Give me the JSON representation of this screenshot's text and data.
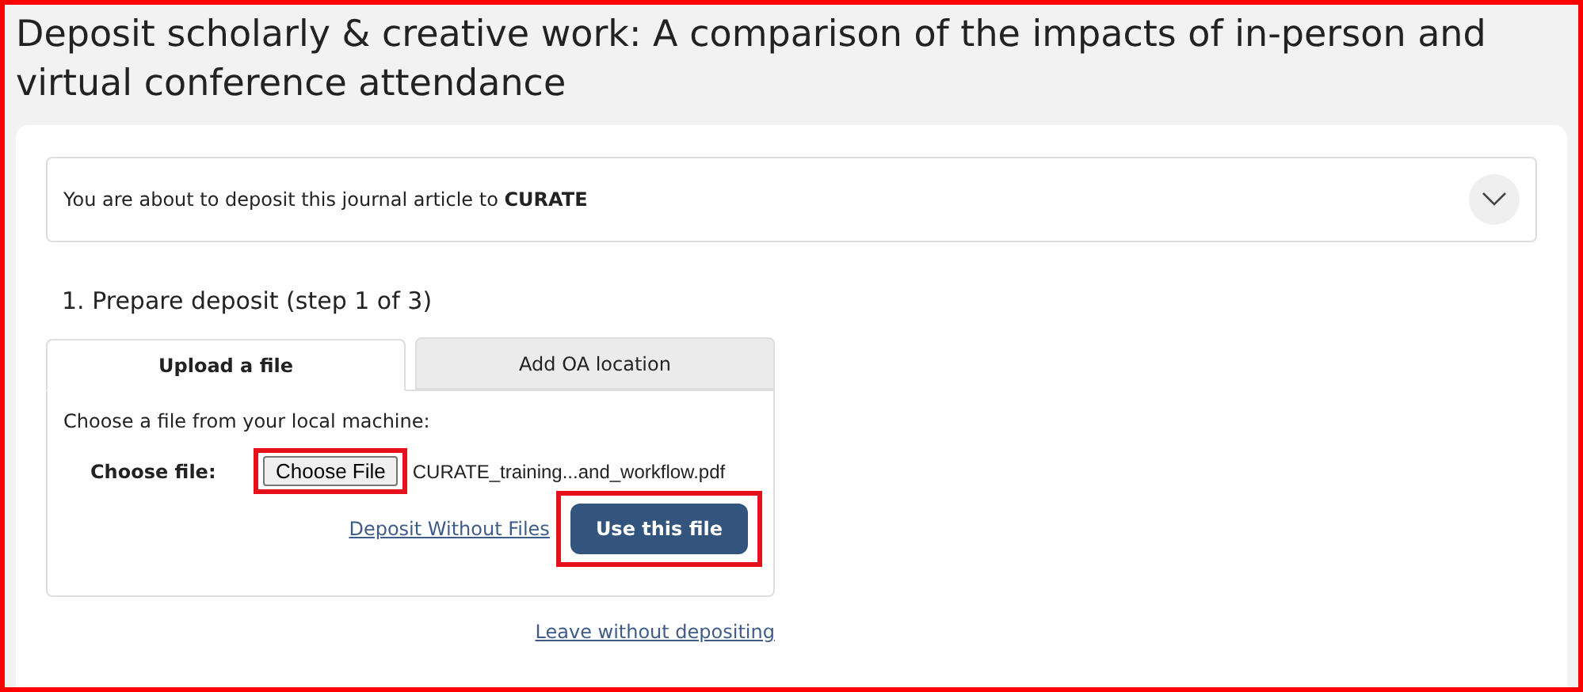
{
  "page_title": "Deposit scholarly & creative work: A comparison of the impacts of in-person and virtual conference attendance",
  "notice": {
    "text": "You are about to deposit this journal article to **CURATE**",
    "expanded": false
  },
  "step_heading": "1. Prepare deposit (step 1 of 3)",
  "tabs": [
    {
      "label": "Upload a file",
      "selected": true
    },
    {
      "label": "Add OA location",
      "selected": false
    }
  ],
  "upload": {
    "instruction": "Choose a file from your local machine:",
    "field_label": "Choose file:",
    "file_button": {
      "label": "Choose File",
      "highlighted": true
    },
    "file_name": "CURATE_training...and_workflow.pdf",
    "deposit_without_files": "Deposit Without Files",
    "use_button": {
      "label": "Use this file",
      "highlighted": true
    }
  },
  "leave_link": "Leave without depositing"
}
